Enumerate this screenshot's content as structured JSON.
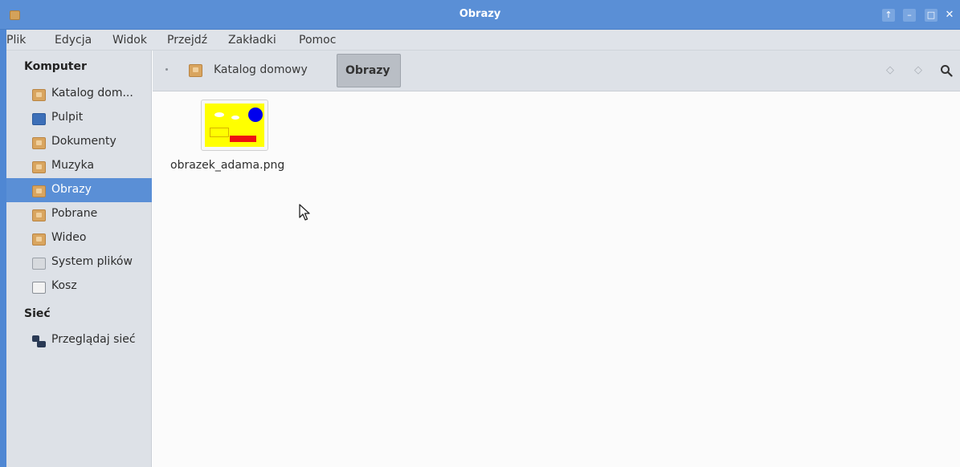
{
  "window": {
    "title": "Obrazy",
    "controls": {
      "up": "↑",
      "minimize": "–",
      "maximize": "□",
      "close": "✕"
    }
  },
  "menubar": {
    "items": [
      "Plik",
      "Edycja",
      "Widok",
      "Przejdź",
      "Zakładki",
      "Pomoc"
    ]
  },
  "sidebar": {
    "sections": [
      {
        "header": "Komputer",
        "items": [
          {
            "label": "Katalog dom...",
            "icon": "home-folder-icon"
          },
          {
            "label": "Pulpit",
            "icon": "desktop-icon"
          },
          {
            "label": "Dokumenty",
            "icon": "documents-folder-icon"
          },
          {
            "label": "Muzyka",
            "icon": "music-folder-icon"
          },
          {
            "label": "Obrazy",
            "icon": "pictures-folder-icon",
            "selected": true
          },
          {
            "label": "Pobrane",
            "icon": "downloads-folder-icon"
          },
          {
            "label": "Wideo",
            "icon": "videos-folder-icon"
          },
          {
            "label": "System plików",
            "icon": "drive-icon"
          },
          {
            "label": "Kosz",
            "icon": "trash-icon"
          }
        ]
      },
      {
        "header": "Sieć",
        "items": [
          {
            "label": "Przeglądaj sieć",
            "icon": "network-icon"
          }
        ]
      }
    ]
  },
  "pathbar": {
    "home_label": "Katalog domowy",
    "current_label": "Obrazy",
    "nav": {
      "back": "◇",
      "forward": "◇",
      "search": "🔍"
    }
  },
  "content": {
    "files": [
      {
        "name": "obrazek_adama.png",
        "type": "image"
      }
    ]
  },
  "colors": {
    "accent": "#5a8fd6",
    "sidebar_bg": "#dde1e7",
    "menubar_bg": "#dfe3e9",
    "content_bg": "#fbfbfb"
  }
}
